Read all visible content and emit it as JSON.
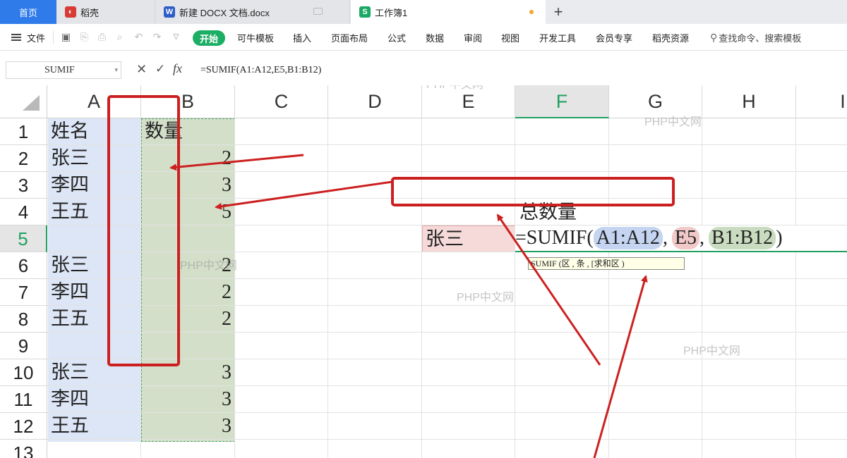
{
  "tabs": [
    {
      "label": "首页"
    },
    {
      "label": "稻壳"
    },
    {
      "label": "新建 DOCX 文档.docx"
    },
    {
      "label": "工作簿1"
    }
  ],
  "tab_add": "+",
  "menu": {
    "file": "文件",
    "start": "开始",
    "items": [
      "可牛模板",
      "插入",
      "页面布局",
      "公式",
      "数据",
      "审阅",
      "视图",
      "开发工具",
      "会员专享",
      "稻壳资源"
    ],
    "search": "查找命令、搜索模板"
  },
  "formula_bar": {
    "name_box": "SUMIF",
    "fx": "fx",
    "formula": "=SUMIF(A1:A12,E5,B1:B12)"
  },
  "columns": [
    "A",
    "B",
    "C",
    "D",
    "E",
    "F",
    "G",
    "H",
    "I"
  ],
  "rows": [
    "1",
    "2",
    "3",
    "4",
    "5",
    "6",
    "7",
    "8",
    "9",
    "10",
    "11",
    "12",
    "13"
  ],
  "cells": {
    "A": [
      "姓名",
      "张三",
      "李四",
      "王五",
      "",
      "张三",
      "李四",
      "王五",
      "",
      "张三",
      "李四",
      "王五"
    ],
    "B": [
      "数量",
      "2",
      "3",
      "5",
      "",
      "2",
      "2",
      "2",
      "",
      "3",
      "3",
      "3"
    ],
    "F4": "总数量",
    "E5": "张三",
    "formula_edit": {
      "prefix": "=SUMIF(",
      "arg1": "A1:A12",
      "sep1": ",",
      "arg2": "E5",
      "sep2": ",",
      "arg3": "B1:B12",
      "suffix": ")"
    },
    "tooltip": "SUMIF (区   ,  条  , [求和区    )"
  },
  "watermark": "PHP中文网",
  "colors": {
    "accent": "#2f7bea",
    "start_green": "#1cae64",
    "range_blue": "#dde6f6",
    "range_green": "#d3dfc9",
    "range_red": "#f6dada",
    "annotation_red": "#cc2020"
  }
}
